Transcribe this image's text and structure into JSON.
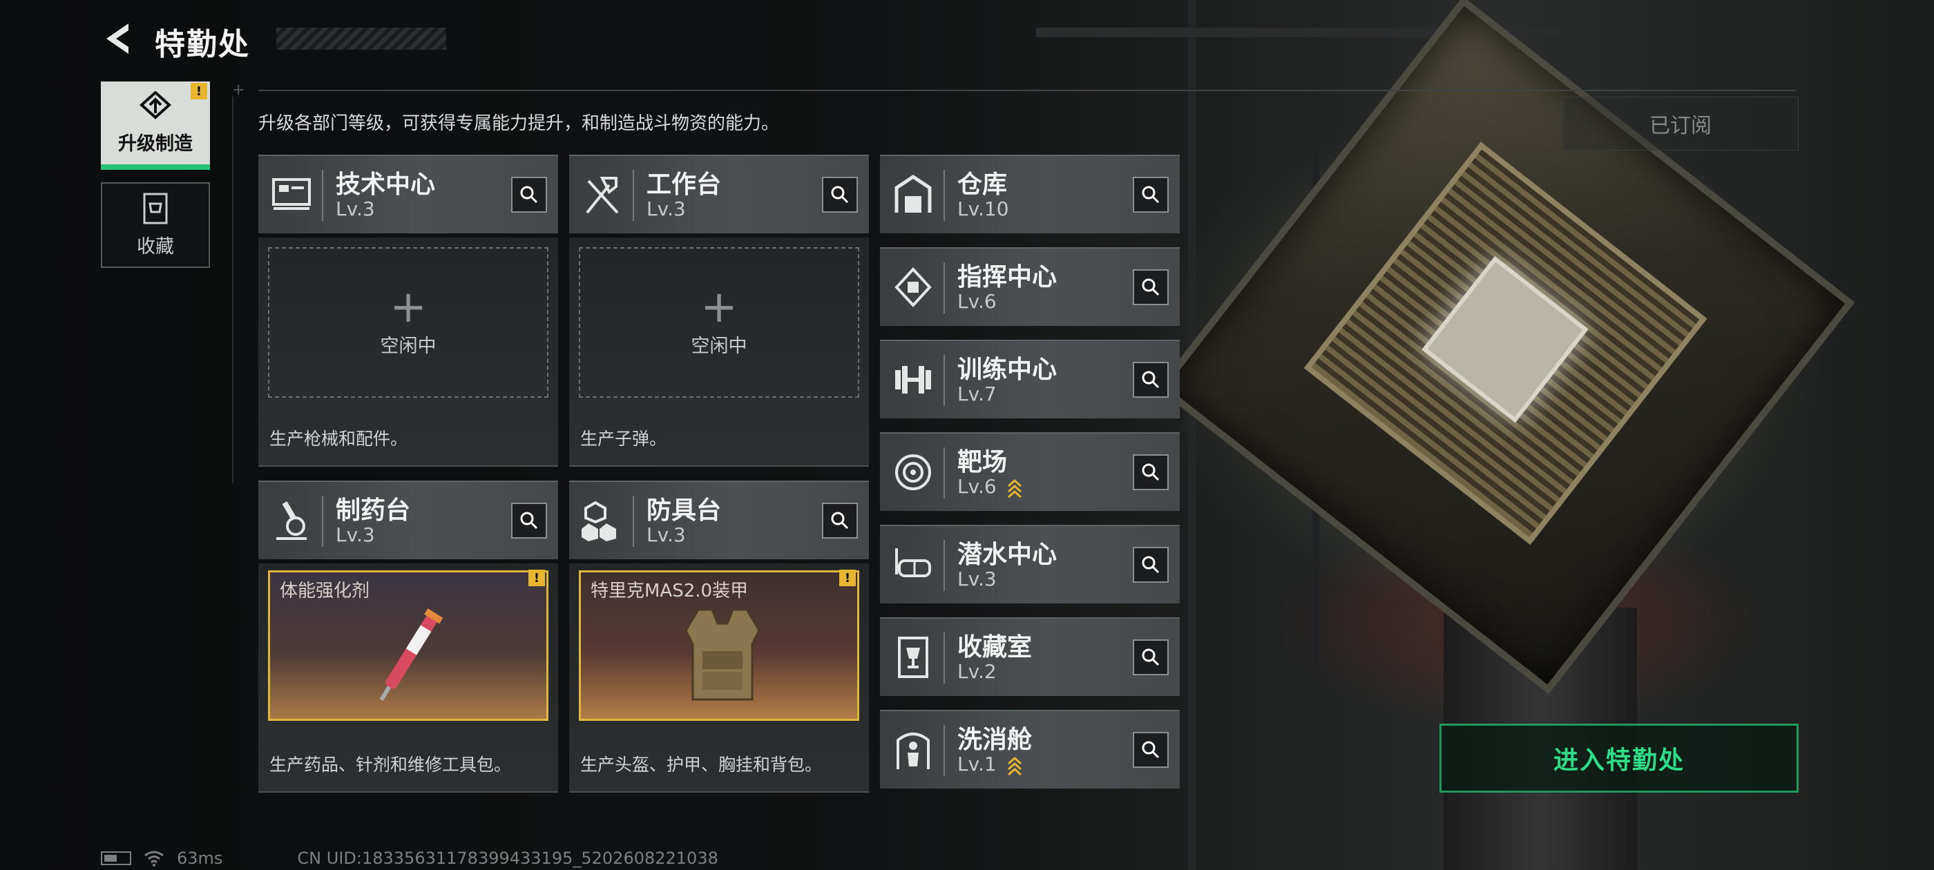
{
  "header": {
    "title": "特勤处"
  },
  "sidebar": {
    "items": [
      {
        "label": "升级制造",
        "active": true,
        "alert": "!"
      },
      {
        "label": "收藏",
        "active": false
      }
    ]
  },
  "main": {
    "description": "升级各部门等级，可获得专属能力提升，和制造战斗物资的能力。",
    "subscribed_label": "已订阅",
    "grid_departments": [
      {
        "name": "技术中心",
        "level": "Lv.3",
        "status": "空闲中",
        "desc": "生产枪械和配件。"
      },
      {
        "name": "工作台",
        "level": "Lv.3",
        "status": "空闲中",
        "desc": "生产子弹。"
      },
      {
        "name": "制药台",
        "level": "Lv.3",
        "crafting": "体能强化剂",
        "alert": "!",
        "desc": "生产药品、针剂和维修工具包。"
      },
      {
        "name": "防具台",
        "level": "Lv.3",
        "crafting": "特里克MAS2.0装甲",
        "alert": "!",
        "desc": "生产头盔、护甲、胸挂和背包。"
      }
    ],
    "list_departments": [
      {
        "name": "仓库",
        "level": "Lv.10"
      },
      {
        "name": "指挥中心",
        "level": "Lv.6"
      },
      {
        "name": "训练中心",
        "level": "Lv.7"
      },
      {
        "name": "靶场",
        "level": "Lv.6",
        "upgradable": true
      },
      {
        "name": "潜水中心",
        "level": "Lv.3"
      },
      {
        "name": "收藏室",
        "level": "Lv.2"
      },
      {
        "name": "洗消舱",
        "level": "Lv.1",
        "upgradable": true
      }
    ],
    "enter_button": "进入特勤处"
  },
  "status_bar": {
    "ping": "63ms",
    "uid": "CN UID:18335631178399433195_5202608221038"
  },
  "colors": {
    "accent": "#2fdc87",
    "alert": "#e8b531",
    "craft_border": "#e1b640"
  },
  "icons": [
    "back-arrow-icon",
    "upgrade-craft-icon",
    "collection-icon",
    "search-icon",
    "computer-icon",
    "hammer-wrench-icon",
    "microscope-icon",
    "armor-cubes-icon",
    "warehouse-icon",
    "command-chip-icon",
    "dumbbell-icon",
    "target-icon",
    "diving-mask-icon",
    "trophy-icon",
    "decontamination-icon"
  ]
}
